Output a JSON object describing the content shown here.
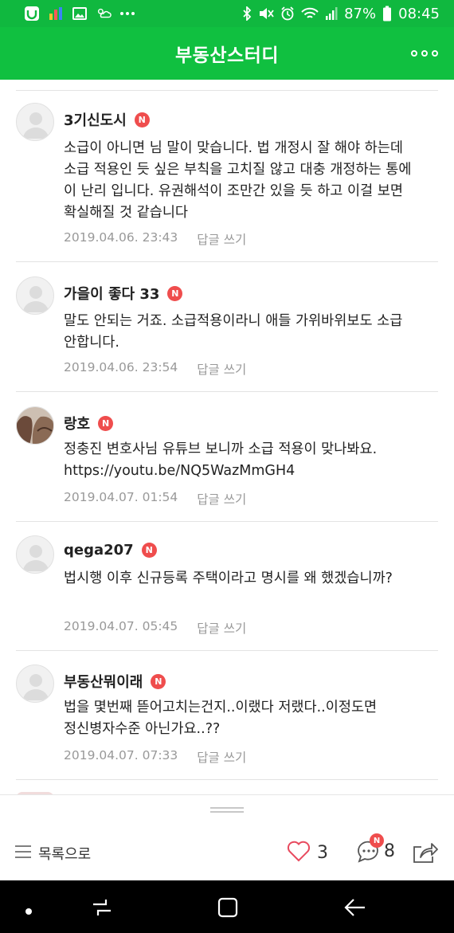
{
  "status_bar": {
    "battery": "87%",
    "time": "08:45",
    "left_icons": [
      "app-notification-icon",
      "chart-app-icon",
      "gallery-icon",
      "weather-icon",
      "more-dots-icon"
    ],
    "right_icons": [
      "bluetooth-icon",
      "mute-icon",
      "alarm-icon",
      "wifi-icon",
      "signal-icon",
      "battery-icon"
    ]
  },
  "header": {
    "title": "부동산스터디",
    "bg_color": "#10c040"
  },
  "comments": [
    {
      "nickname": "3기신도시",
      "badge": "N",
      "text": "소급이 아니면 님 말이 맞습니다. 법 개정시 잘 해야 하는데 소급 적용인 듯 싶은 부칙을 고치질 않고 대충 개정하는 통에 이 난리 입니다. 유권해석이 조만간 있을 듯 하고 이걸 보면 확실해질 것 같습니다",
      "date": "2019.04.06. 23:43",
      "reply": "답글 쓰기"
    },
    {
      "nickname": "가을이 좋다 33",
      "badge": "N",
      "text": "말도 안되는 거죠. 소급적용이라니 애들 가위바위보도 소급 안합니다.",
      "date": "2019.04.06. 23:54",
      "reply": "답글 쓰기"
    },
    {
      "nickname": "랑호",
      "badge": "N",
      "text": "정충진 변호사님 유튜브 보니까 소급 적용이 맞나봐요. https://youtu.be/NQ5WazMmGH4",
      "date": "2019.04.07. 01:54",
      "reply": "답글 쓰기"
    },
    {
      "nickname": "qega207",
      "badge": "N",
      "text": "법시행 이후 신규등록 주택이라고 명시를 왜 했겠습니까?",
      "date": "2019.04.07. 05:45",
      "reply": "답글 쓰기"
    },
    {
      "nickname": "부동산뭐이래",
      "badge": "N",
      "text": "법을 몇번째 뜯어고치는건지..이랬다 저랬다..이정도면 정신병자수준 아닌가요..??",
      "date": "2019.04.07. 07:33",
      "reply": "답글 쓰기"
    }
  ],
  "bottom_bar": {
    "list_label": "목록으로",
    "like_count": "3",
    "comment_count": "8",
    "comment_badge": "N"
  },
  "colors": {
    "accent": "#10c040",
    "badge": "#ef4d4d",
    "meta_text": "#999999"
  }
}
